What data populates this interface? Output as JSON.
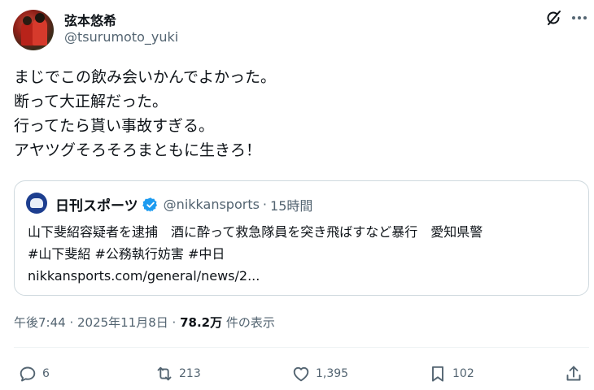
{
  "author": {
    "name": "弦本悠希",
    "handle": "@tsurumoto_yuki"
  },
  "tweet": {
    "lines": [
      "まじでこの飲み会いかんでよかった。",
      "断って大正解だった。",
      "行ってたら貰い事故すぎる。",
      "アヤツグそろそろまともに生きろ！"
    ]
  },
  "quote": {
    "name": "日刊スポーツ",
    "handle": "@nikkansports",
    "separator": "·",
    "time": "15時間",
    "lines": [
      "山下斐紹容疑者を逮捕　酒に酔って救急隊員を突き飛ばすなど暴行　愛知県警",
      "#山下斐紹 #公務執行妨害 #中日",
      "nikkansports.com/general/news/2..."
    ]
  },
  "meta": {
    "datetime": "午後7:44 · 2025年11月8日 · ",
    "views": "78.2万",
    "views_suffix": " 件の表示"
  },
  "actions": {
    "replies": "6",
    "reposts": "213",
    "likes": "1,395",
    "bookmarks": "102"
  },
  "icons": {
    "grok": "grok-icon",
    "more": "more-icon",
    "verified": "verified-badge-icon",
    "reply": "reply-icon",
    "repost": "repost-icon",
    "like": "like-icon",
    "bookmark": "bookmark-icon",
    "share": "share-icon"
  },
  "colors": {
    "text": "#0f1419",
    "secondary": "#536471",
    "border": "#cfd9de",
    "verified": "#1d9bf0"
  }
}
